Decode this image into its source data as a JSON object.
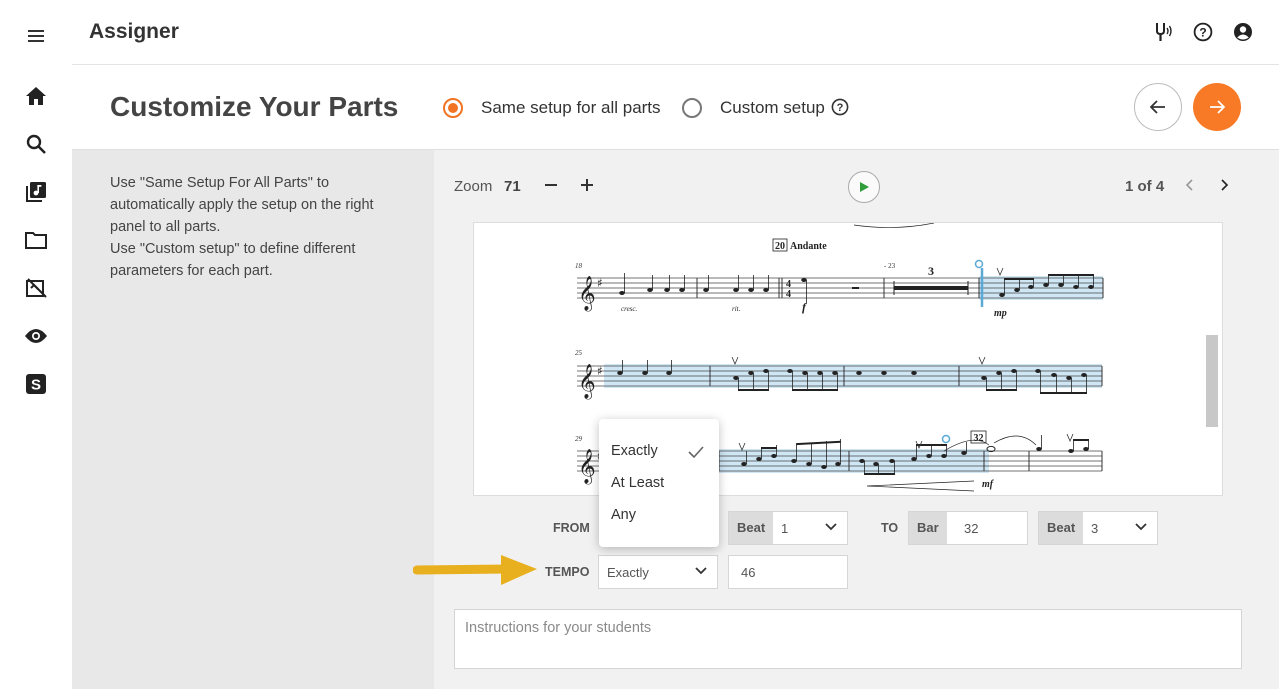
{
  "app": {
    "title": "Assigner"
  },
  "sidebar": {
    "icons": [
      "menu-icon",
      "home-icon",
      "search-icon",
      "music-library-icon",
      "folder-icon",
      "assignment-icon",
      "eye-icon",
      "s-logo-icon"
    ]
  },
  "header": {
    "title": "Customize Your Parts",
    "options": [
      {
        "label": "Same setup for all parts",
        "selected": true
      },
      {
        "label": "Custom setup",
        "selected": false
      }
    ]
  },
  "help": {
    "line1": "Use \"Same Setup For All Parts\" to automatically apply the setup on the right panel to all parts.",
    "line2": "Use \"Custom setup\" to define different parameters for each part."
  },
  "viewer": {
    "zoom_label": "Zoom",
    "zoom_value": "71",
    "page_indicator": "1 of 4"
  },
  "score": {
    "rehearsal_mark": "20",
    "tempo_text": "Andante",
    "bar_numbers": [
      "18",
      "25",
      "29"
    ],
    "dynamics": [
      "cresc.",
      "rit.",
      "f",
      "mp",
      "mf"
    ],
    "multirest": "3",
    "multirest_range": "- 23",
    "rehearsal_mark_2": "32"
  },
  "range": {
    "from_label": "FROM",
    "from_beat_tag": "Beat",
    "from_beat_value": "1",
    "to_label": "TO",
    "to_bar_tag": "Bar",
    "to_bar_value": "32",
    "to_beat_tag": "Beat",
    "to_beat_value": "3"
  },
  "tempo": {
    "label": "TEMPO",
    "mode": "Exactly",
    "value": "46",
    "options": [
      "Exactly",
      "At Least",
      "Any"
    ]
  },
  "instructions": {
    "placeholder": "Instructions for your students"
  },
  "colors": {
    "accent": "#f97a26",
    "highlight": "#cfe6f5",
    "play": "#2e9d3a"
  }
}
